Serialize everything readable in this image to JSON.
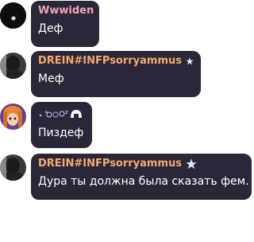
{
  "messages": [
    {
      "author": "Wwwiden",
      "author_color": "#f0a3b4",
      "text": "Деф",
      "avatar": "dark-avatar"
    },
    {
      "author": "DREIN#INFPsorryammus",
      "author_color": "#f7a86b",
      "text": "Меф",
      "avatar": "photo-avatar",
      "badge": "star-badge-icon"
    },
    {
      "author_icon": "decorative-symbols-nickname",
      "text": "Пиздеф",
      "avatar": "anime-avatar"
    },
    {
      "author": "DREIN#INFPsorryammus",
      "author_color": "#f7a86b",
      "text": "Дура ты должна была сказать фем.",
      "avatar": "photo-avatar",
      "badge": "star-badge-icon"
    }
  ],
  "colors": {
    "bubble_bg": "#2a2838",
    "message_text": "#ffffff"
  }
}
